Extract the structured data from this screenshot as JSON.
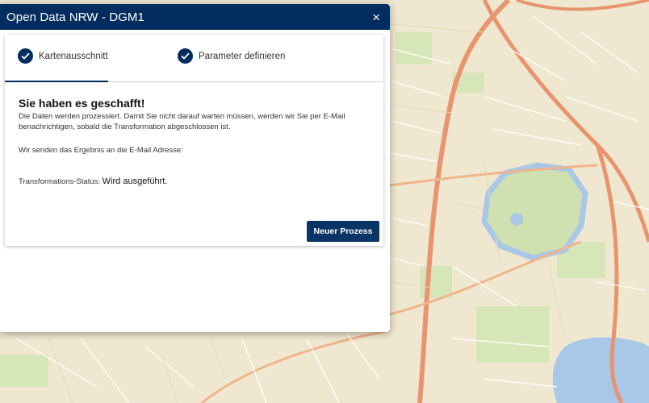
{
  "dialog": {
    "title": "Open Data NRW - DGM1",
    "close_label": "×"
  },
  "steps": [
    {
      "label": "Kartenausschnitt"
    },
    {
      "label": "Parameter definieren"
    }
  ],
  "result": {
    "heading": "Sie haben es geschafft!",
    "description": "Die Daten werden prozessiert. Damit Sie nicht darauf warten müssen, werden wir Sie per E-Mail benachrichtigen, sobald die Transformation abgeschlossen ist.",
    "email_line": "Wir senden das Ergebnis an die E-Mail Adresse:",
    "status_label": "Transformations-Status:",
    "status_value": "Wird ausgeführt."
  },
  "actions": {
    "new_process_label": "Neuer Prozess"
  },
  "colors": {
    "primary": "#022d5e",
    "map_background": "#efe7cf",
    "map_water": "#a9c7e6",
    "map_road": "#e8956f"
  }
}
